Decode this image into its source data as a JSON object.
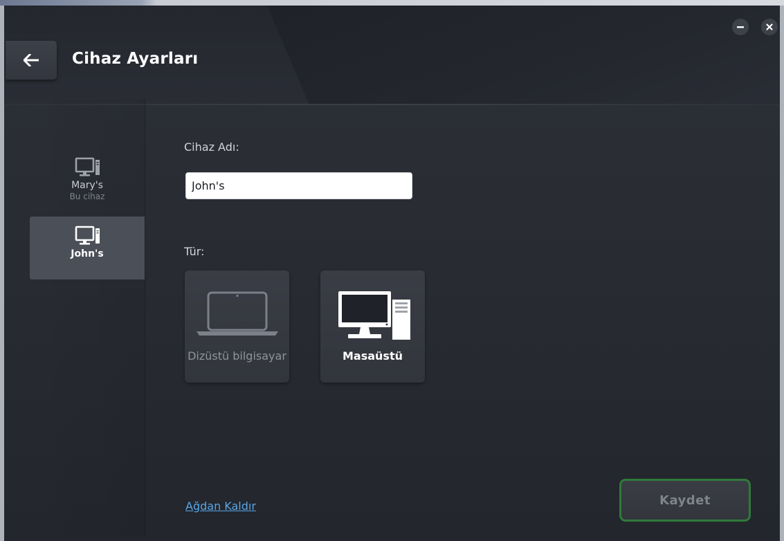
{
  "header": {
    "title": "Cihaz Ayarları"
  },
  "sidebar": {
    "devices": [
      {
        "name": "Mary's",
        "subtitle": "Bu cihaz",
        "selected": false
      },
      {
        "name": "John's",
        "subtitle": "",
        "selected": true
      }
    ]
  },
  "form": {
    "name_label": "Cihaz Adı:",
    "name_value": "John's",
    "type_label": "Tür:",
    "types": [
      {
        "label": "Dizüstü bilgisayar",
        "icon": "laptop-icon",
        "selected": false
      },
      {
        "label": "Masaüstü",
        "icon": "desktop-computer-icon",
        "selected": true
      }
    ]
  },
  "footer": {
    "remove_link": "Ağdan Kaldır",
    "save_label": "Kaydet"
  },
  "colors": {
    "background": "#292c33",
    "selected_item": "#4b4f58",
    "link": "#58a6e6",
    "save_border": "#2f7a3a"
  }
}
